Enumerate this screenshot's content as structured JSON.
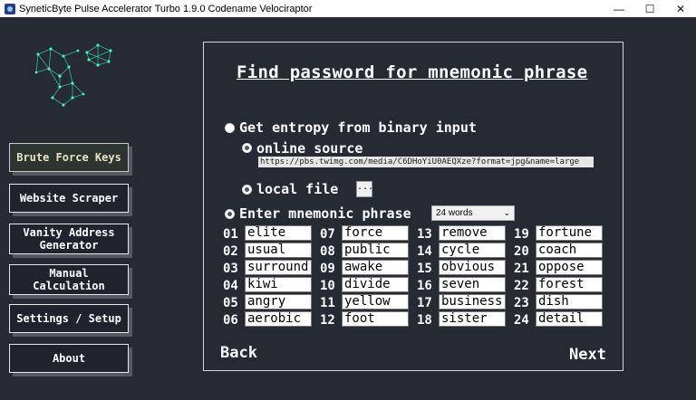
{
  "window": {
    "title": "SyneticByte Pulse Accelerator Turbo 1.9.0 Codename Velociraptor",
    "minimize": "—",
    "maximize": "☐",
    "close": "✕"
  },
  "sidebar": {
    "items": [
      {
        "label": "Brute Force Keys",
        "active": true
      },
      {
        "label": "Website Scraper",
        "active": false
      },
      {
        "label": "Vanity Address Generator",
        "active": false
      },
      {
        "label": "Manual Calculation",
        "active": false
      },
      {
        "label": "Settings / Setup",
        "active": false
      },
      {
        "label": "About",
        "active": false
      }
    ]
  },
  "panel": {
    "title": "Find password for mnemonic phrase",
    "entropy_option": "Get entropy from binary input",
    "online_source": "online source",
    "url": "https://pbs.twimg.com/media/C6DHoYiU0AEQXze?format=jpg&name=large",
    "local_file": "local file",
    "browse_label": "...",
    "mnemonic_option": "Enter mnemonic phrase",
    "word_count": "24 words",
    "words": [
      {
        "num": "01",
        "word": "elite"
      },
      {
        "num": "02",
        "word": "usual"
      },
      {
        "num": "03",
        "word": "surround"
      },
      {
        "num": "04",
        "word": "kiwi"
      },
      {
        "num": "05",
        "word": "angry"
      },
      {
        "num": "06",
        "word": "aerobic"
      },
      {
        "num": "07",
        "word": "force"
      },
      {
        "num": "08",
        "word": "public"
      },
      {
        "num": "09",
        "word": "awake"
      },
      {
        "num": "10",
        "word": "divide"
      },
      {
        "num": "11",
        "word": "yellow"
      },
      {
        "num": "12",
        "word": "foot"
      },
      {
        "num": "13",
        "word": "remove"
      },
      {
        "num": "14",
        "word": "cycle"
      },
      {
        "num": "15",
        "word": "obvious"
      },
      {
        "num": "16",
        "word": "seven"
      },
      {
        "num": "17",
        "word": "business"
      },
      {
        "num": "18",
        "word": "sister"
      },
      {
        "num": "19",
        "word": "fortune"
      },
      {
        "num": "20",
        "word": "coach"
      },
      {
        "num": "21",
        "word": "oppose"
      },
      {
        "num": "22",
        "word": "forest"
      },
      {
        "num": "23",
        "word": "dish"
      },
      {
        "num": "24",
        "word": "detail"
      }
    ],
    "back_label": "Back",
    "next_label": "Next"
  },
  "colors": {
    "background": "#252a33",
    "panel_border": "#d8d8d8",
    "logo": "#33e0a0"
  },
  "icons": {
    "logo": "network-logo-icon",
    "browse": "ellipsis-icon",
    "dropdown": "chevron-down-icon"
  }
}
